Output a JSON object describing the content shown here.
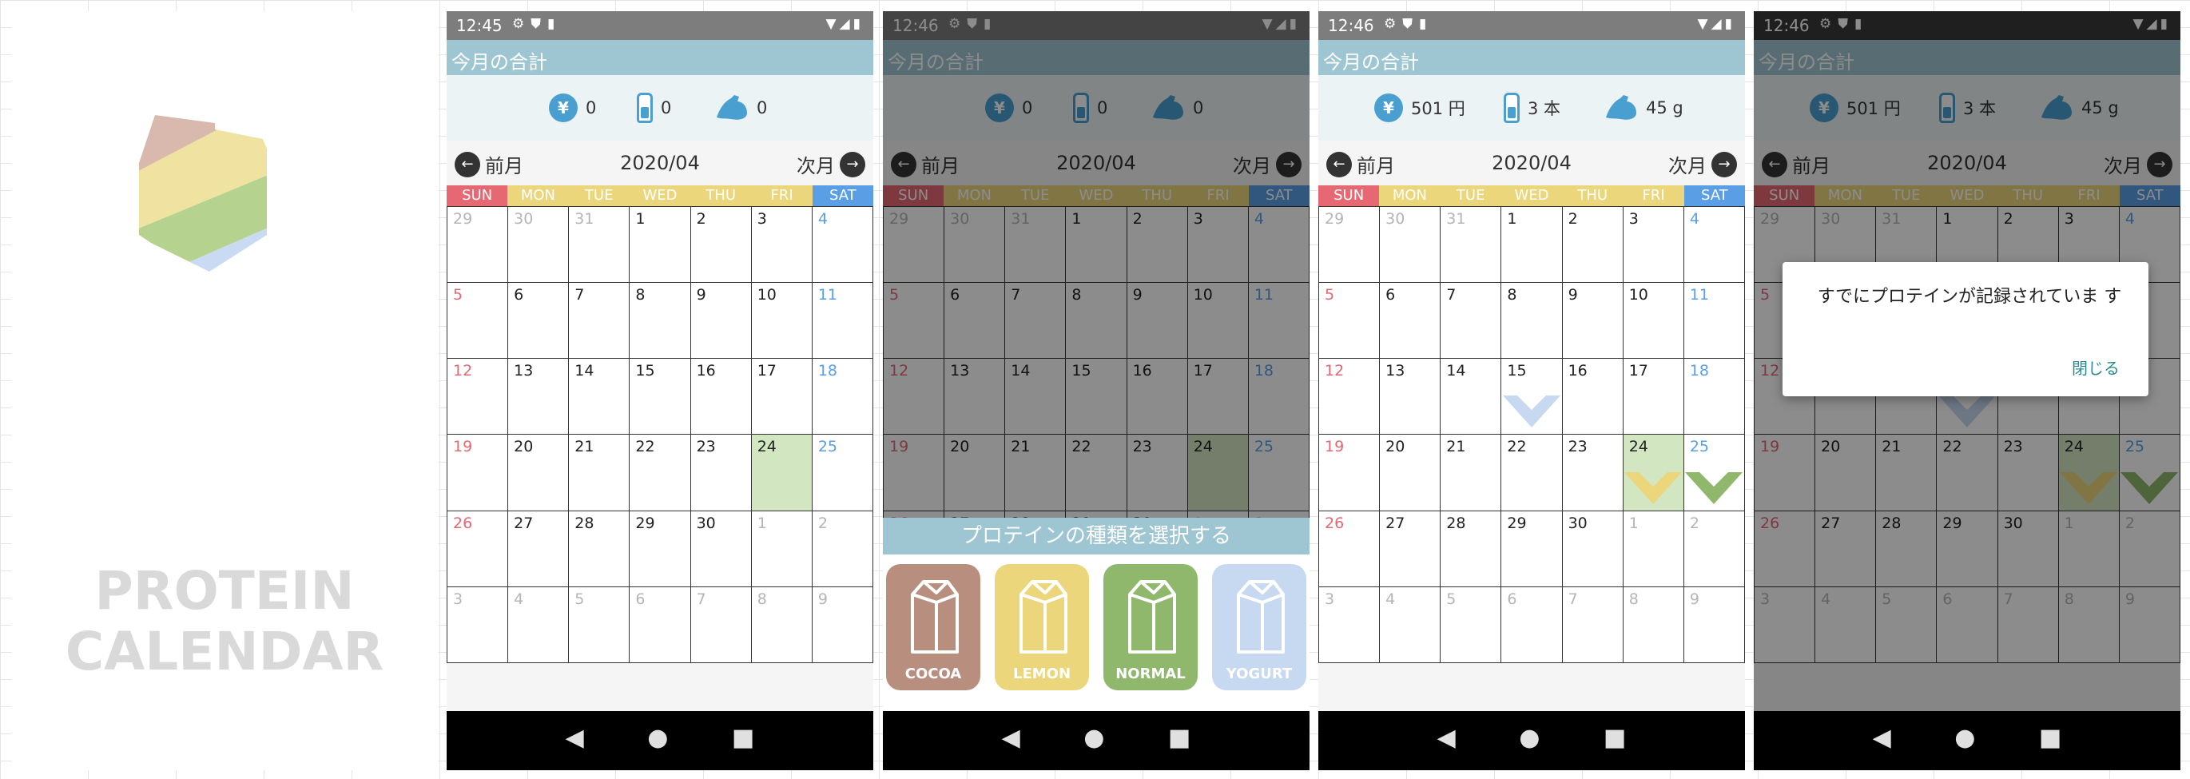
{
  "logo": {
    "title_line1": "PROTEIN",
    "title_line2": "CALENDAR"
  },
  "colors": {
    "cocoa": "#b88f7f",
    "lemon": "#ecd67c",
    "normal": "#8fb86c",
    "yogurt": "#c6d9f0",
    "header_bar": "#9ec5d2",
    "sun": "#e56873",
    "mon_fri": "#ecd67c",
    "sat": "#5a9ee6"
  },
  "panels": [
    {
      "time": "12:45",
      "summary_title": "今月の合計",
      "money": "0",
      "count": "0",
      "grams": "0",
      "prev": "前月",
      "month": "2020/04",
      "next": "次月"
    },
    {
      "time": "12:46",
      "summary_title": "今月の合計",
      "money": "0",
      "count": "0",
      "grams": "0",
      "prev": "前月",
      "month": "2020/04",
      "next": "次月"
    },
    {
      "time": "12:46",
      "summary_title": "今月の合計",
      "money": "501 円",
      "count": "3 本",
      "grams": "45 g",
      "prev": "前月",
      "month": "2020/04",
      "next": "次月"
    },
    {
      "time": "12:46",
      "summary_title": "今月の合計",
      "money": "501 円",
      "count": "3 本",
      "grams": "45 g",
      "prev": "前月",
      "month": "2020/04",
      "next": "次月"
    }
  ],
  "weekdays": [
    "SUN",
    "MON",
    "TUE",
    "WED",
    "THU",
    "FRI",
    "SAT"
  ],
  "calendar_days": [
    "29",
    "30",
    "31",
    "1",
    "2",
    "3",
    "4",
    "5",
    "6",
    "7",
    "8",
    "9",
    "10",
    "11",
    "12",
    "13",
    "14",
    "15",
    "16",
    "17",
    "18",
    "19",
    "20",
    "21",
    "22",
    "23",
    "24",
    "25",
    "26",
    "27",
    "28",
    "29",
    "30",
    "1",
    "2",
    "3",
    "4",
    "5",
    "6",
    "7",
    "8",
    "9"
  ],
  "picker": {
    "title": "プロテインの種類を選択する",
    "options": [
      "COCOA",
      "LEMON",
      "NORMAL",
      "YOGURT"
    ]
  },
  "records": [
    {
      "day": "15",
      "flavor": "YOGURT"
    },
    {
      "day": "24",
      "flavor": "LEMON"
    },
    {
      "day": "25",
      "flavor": "NORMAL"
    }
  ],
  "dialog": {
    "message": "すでにプロテインが記録されていま す",
    "close": "閉じる"
  },
  "icons": [
    "yen-bag-icon",
    "bottle-icon",
    "arm-icon",
    "prev-circle-icon",
    "next-circle-icon",
    "gear-icon",
    "shield-icon",
    "sdcard-icon",
    "wifi-icon",
    "signal-icon",
    "battery-icon",
    "back-icon",
    "home-icon",
    "recents-icon",
    "milk-carton-icon"
  ]
}
